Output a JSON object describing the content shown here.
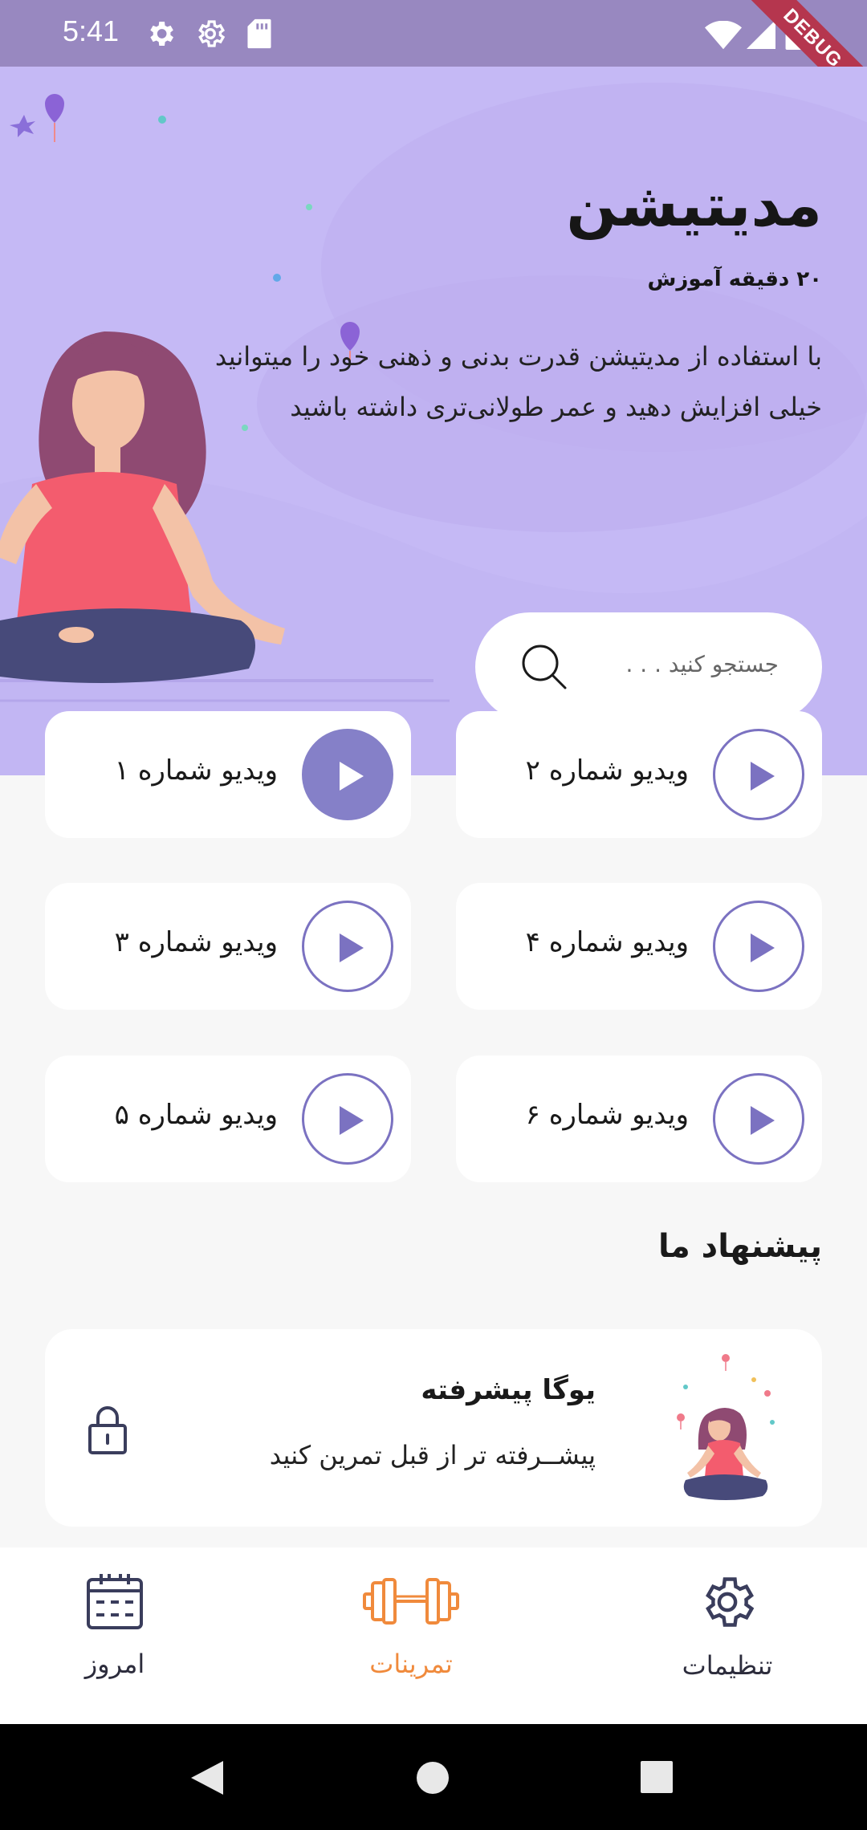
{
  "status_bar": {
    "time": "5:41"
  },
  "debug_banner": "DEBUG",
  "hero": {
    "title": "مدیتیشن",
    "subtitle": "۲۰ دقیقه آموزش",
    "description": "با استفاده از مدیتیشن قدرت بدنی و ذهنی خود را میتوانید خیلی افزایش دهید و عمر طولانی‌تری داشته باشید"
  },
  "search": {
    "placeholder": "جستجو کنید . . ."
  },
  "videos": [
    {
      "label": "ویدیو شماره ۱",
      "active": true
    },
    {
      "label": "ویدیو شماره ۲",
      "active": false
    },
    {
      "label": "ویدیو شماره ۳",
      "active": false
    },
    {
      "label": "ویدیو شماره ۴",
      "active": false
    },
    {
      "label": "ویدیو شماره ۵",
      "active": false
    },
    {
      "label": "ویدیو شماره ۶",
      "active": false
    }
  ],
  "suggestions": {
    "title": "پیشنهاد ما",
    "card": {
      "title": "یوگا پیشرفته",
      "subtitle": "پیشــرفته تر از قبل تمرین کنید",
      "locked": true
    }
  },
  "bottom_nav": [
    {
      "label": "امروز",
      "icon": "calendar-icon",
      "active": false
    },
    {
      "label": "تمرینات",
      "icon": "dumbbell-icon",
      "active": true
    },
    {
      "label": "تنظیمات",
      "icon": "gear-icon",
      "active": false
    }
  ],
  "colors": {
    "hero_bg": "#c5b9f5",
    "status_bar": "#9888c0",
    "accent_purple": "#7b72c1",
    "active_orange": "#f08a3c",
    "debug_ribbon": "#b5364e"
  }
}
